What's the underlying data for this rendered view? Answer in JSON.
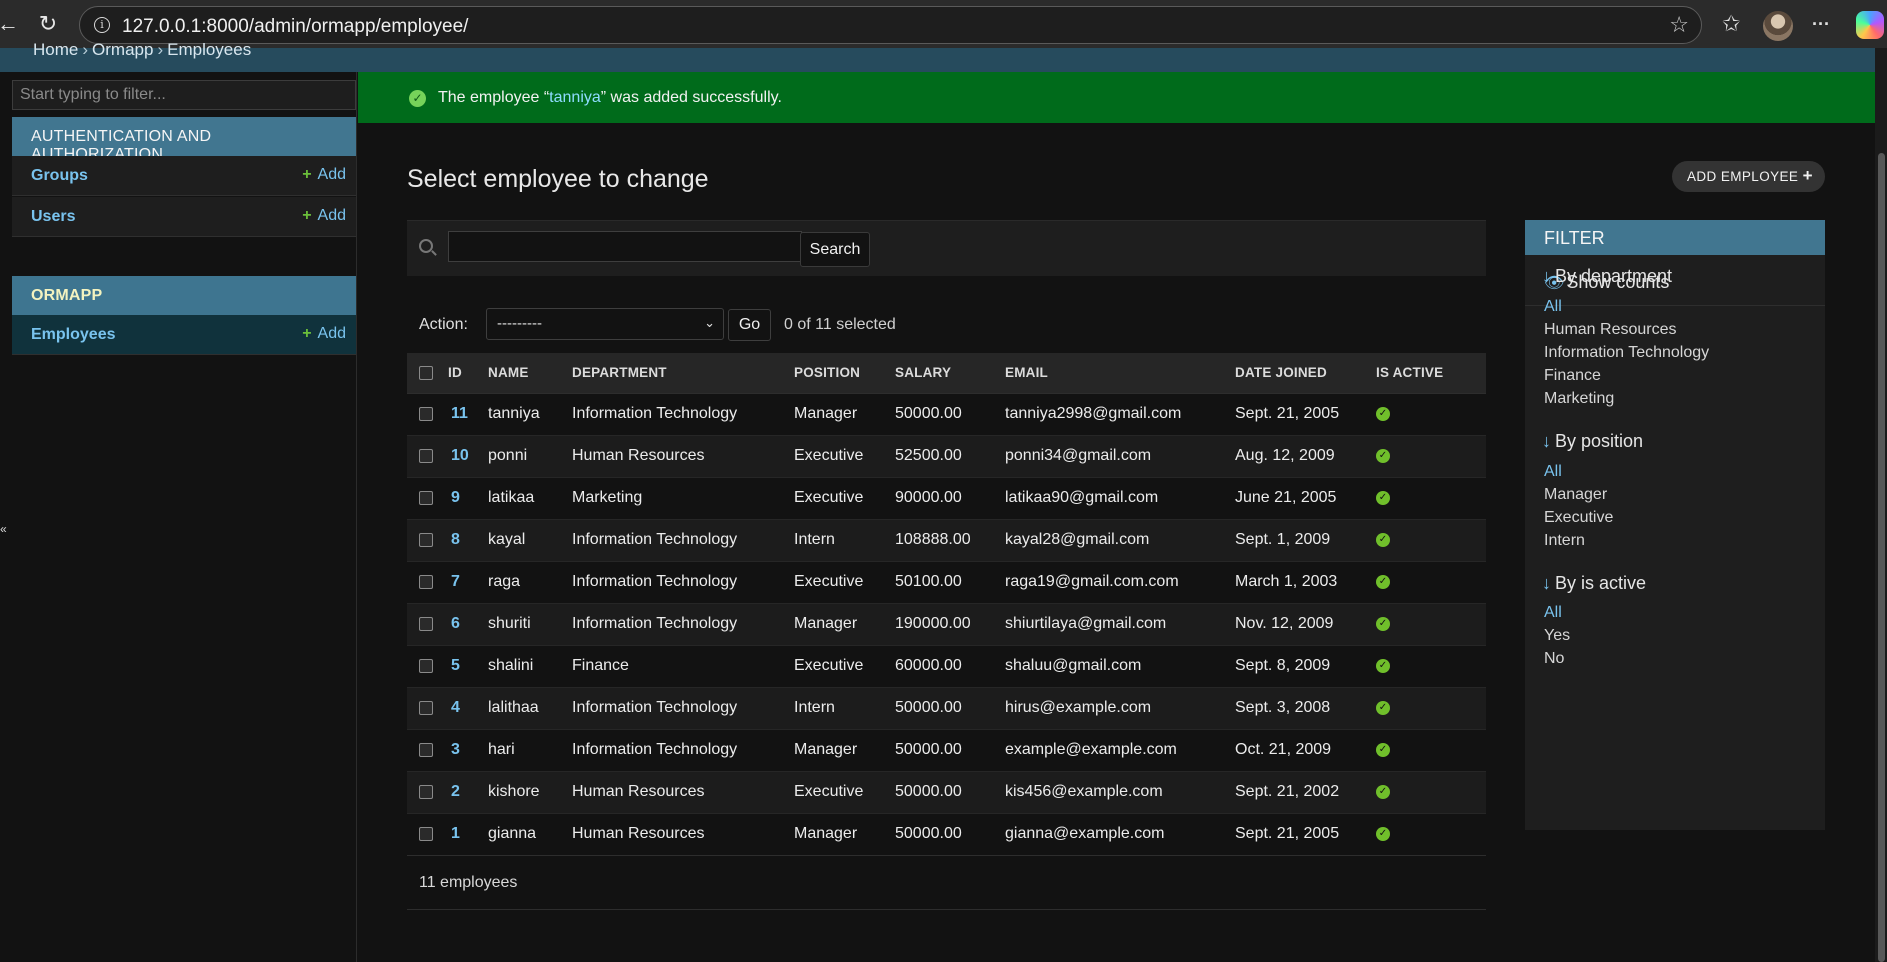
{
  "browser": {
    "url": "127.0.0.1:8000/admin/ormapp/employee/",
    "icons": [
      "back-icon",
      "refresh-icon",
      "info-icon",
      "star-icon",
      "favorites-icon",
      "avatar",
      "more-icon",
      "copilot-icon"
    ],
    "back_glyph": "←",
    "refresh_glyph": "↻",
    "info_glyph": "i",
    "star_glyph": "☆",
    "favorites_glyph": "✩",
    "more_glyph": "···"
  },
  "breadcrumb": {
    "home": "Home",
    "app": "Ormapp",
    "current": "Employees",
    "separator": "›"
  },
  "sidebar": {
    "filter_placeholder": "Start typing to filter...",
    "modules": [
      {
        "caption": "AUTHENTICATION AND AUTHORIZATION",
        "models": [
          {
            "name": "Groups",
            "add": "Add"
          },
          {
            "name": "Users",
            "add": "Add"
          }
        ]
      },
      {
        "caption": "ORMAPP",
        "models": [
          {
            "name": "Employees",
            "add": "Add"
          }
        ]
      }
    ],
    "collapse_glyph": "«",
    "add_plus": "+"
  },
  "message": {
    "prefix": "The employee “",
    "object": "tanniya",
    "suffix": "” was added successfully.",
    "icon_glyph": "✓"
  },
  "content": {
    "title": "Select employee to change",
    "add_button": "ADD EMPLOYEE",
    "add_button_icon": "+",
    "search_button": "Search",
    "action_label": "Action:",
    "action_selected": "---------",
    "action_chevron": "⌄",
    "go_button": "Go",
    "selection_counter": "0 of 11 selected",
    "paginator": "11 employees"
  },
  "table": {
    "headers": [
      "ID",
      "NAME",
      "DEPARTMENT",
      "POSITION",
      "SALARY",
      "EMAIL",
      "DATE JOINED",
      "IS ACTIVE"
    ],
    "active_glyph": "✓",
    "rows": [
      {
        "id": "11",
        "name": "tanniya",
        "department": "Information Technology",
        "position": "Manager",
        "salary": "50000.00",
        "email": "tanniya2998@gmail.com",
        "date_joined": "Sept. 21, 2005",
        "is_active": true
      },
      {
        "id": "10",
        "name": "ponni",
        "department": "Human Resources",
        "position": "Executive",
        "salary": "52500.00",
        "email": "ponni34@gmail.com",
        "date_joined": "Aug. 12, 2009",
        "is_active": true
      },
      {
        "id": "9",
        "name": "latikaa",
        "department": "Marketing",
        "position": "Executive",
        "salary": "90000.00",
        "email": "latikaa90@gmail.com",
        "date_joined": "June 21, 2005",
        "is_active": true
      },
      {
        "id": "8",
        "name": "kayal",
        "department": "Information Technology",
        "position": "Intern",
        "salary": "108888.00",
        "email": "kayal28@gmail.com",
        "date_joined": "Sept. 1, 2009",
        "is_active": true
      },
      {
        "id": "7",
        "name": "raga",
        "department": "Information Technology",
        "position": "Executive",
        "salary": "50100.00",
        "email": "raga19@gmail.com.com",
        "date_joined": "March 1, 2003",
        "is_active": true
      },
      {
        "id": "6",
        "name": "shuriti",
        "department": "Information Technology",
        "position": "Manager",
        "salary": "190000.00",
        "email": "shiurtilaya@gmail.com",
        "date_joined": "Nov. 12, 2009",
        "is_active": true
      },
      {
        "id": "5",
        "name": "shalini",
        "department": "Finance",
        "position": "Executive",
        "salary": "60000.00",
        "email": "shaluu@gmail.com",
        "date_joined": "Sept. 8, 2009",
        "is_active": true
      },
      {
        "id": "4",
        "name": "lalithaa",
        "department": "Information Technology",
        "position": "Intern",
        "salary": "50000.00",
        "email": "hirus@example.com",
        "date_joined": "Sept. 3, 2008",
        "is_active": true
      },
      {
        "id": "3",
        "name": "hari",
        "department": "Information Technology",
        "position": "Manager",
        "salary": "50000.00",
        "email": "example@example.com",
        "date_joined": "Oct. 21, 2009",
        "is_active": true
      },
      {
        "id": "2",
        "name": "kishore",
        "department": "Human Resources",
        "position": "Executive",
        "salary": "50000.00",
        "email": "kis456@example.com",
        "date_joined": "Sept. 21, 2002",
        "is_active": true
      },
      {
        "id": "1",
        "name": "gianna",
        "department": "Human Resources",
        "position": "Manager",
        "salary": "50000.00",
        "email": "gianna@example.com",
        "date_joined": "Sept. 21, 2005",
        "is_active": true
      }
    ]
  },
  "filter": {
    "title": "FILTER",
    "show_counts": "Show counts",
    "eye_glyph": "👁",
    "arrow_glyph": "↓",
    "groups": [
      {
        "title": "By department",
        "options": [
          "All",
          "Human Resources",
          "Information Technology",
          "Finance",
          "Marketing"
        ],
        "selected": "All"
      },
      {
        "title": "By position",
        "options": [
          "All",
          "Manager",
          "Executive",
          "Intern"
        ],
        "selected": "All"
      },
      {
        "title": "By is active",
        "options": [
          "All",
          "Yes",
          "No"
        ],
        "selected": "All"
      }
    ]
  },
  "colors": {
    "header_blue": "#417690",
    "link_blue": "#79c3ee",
    "success_green": "#006b1b",
    "active_green": "#70bf2b",
    "add_plus_green": "#6bbf3a"
  }
}
